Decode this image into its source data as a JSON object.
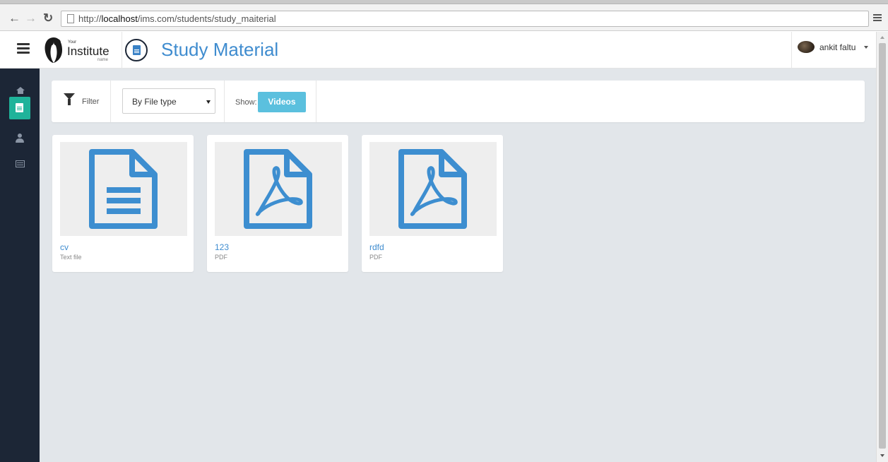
{
  "browser": {
    "url_prefix": "http://",
    "url_host": "localhost",
    "url_path": "/ims.com/students/study_maiterial"
  },
  "header": {
    "logo_your": "Your",
    "logo_institute": "Institute",
    "logo_name": "name",
    "page_title": "Study Material",
    "user_name": "ankit faltu"
  },
  "filter_bar": {
    "filter_label": "Filter",
    "select_value": "By File type",
    "show_label": "Show:",
    "videos_button": "Videos"
  },
  "files": [
    {
      "name": "cv",
      "type": "Text file",
      "icon": "text-file-icon"
    },
    {
      "name": "123",
      "type": "PDF",
      "icon": "pdf-file-icon"
    },
    {
      "name": "rdfd",
      "type": "PDF",
      "icon": "pdf-file-icon"
    }
  ],
  "sidebar": {
    "items": [
      {
        "icon": "home-icon"
      },
      {
        "icon": "document-icon",
        "active": true
      },
      {
        "icon": "user-icon"
      },
      {
        "icon": "card-icon"
      }
    ]
  },
  "colors": {
    "accent": "#3f8ccf",
    "sidebar_bg": "#1c2636",
    "sidebar_active": "#1fb39a",
    "videos_button": "#5bc0de",
    "content_bg": "#e2e6ea"
  }
}
